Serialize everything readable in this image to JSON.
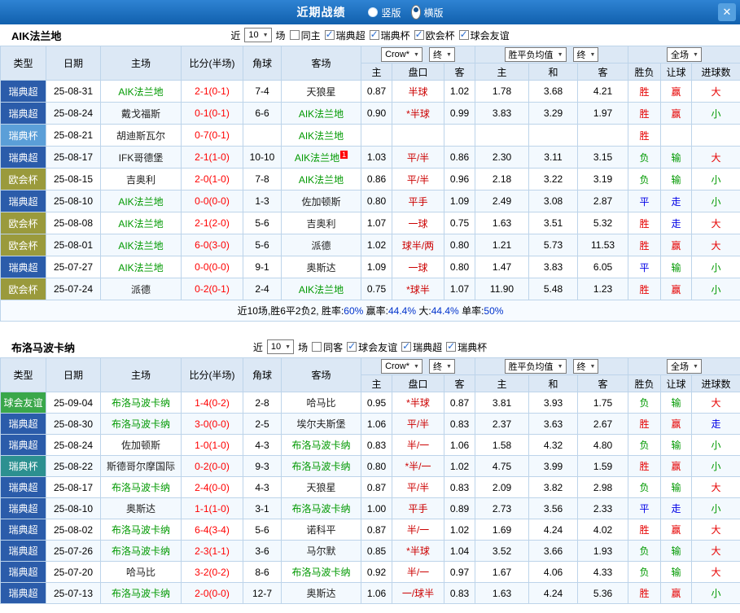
{
  "header": {
    "title": "近期战绩",
    "radios": [
      {
        "label": "竖版",
        "selected": false
      },
      {
        "label": "横版",
        "selected": true
      }
    ],
    "close_icon": "✕"
  },
  "filter_labels": {
    "near": "近",
    "games": "场"
  },
  "table_header": {
    "static_cols": [
      "类型",
      "日期",
      "主场",
      "比分(半场)",
      "角球",
      "客场"
    ],
    "odds_selects": [
      "Crow*",
      "终"
    ],
    "odds_subcols": [
      "主",
      "盘口",
      "客"
    ],
    "avg_selects": [
      "胜平负均值",
      "终"
    ],
    "avg_subcols": [
      "主",
      "和",
      "客"
    ],
    "result_selects": [
      "全场"
    ],
    "result_subcols": [
      "胜负",
      "让球",
      "进球数"
    ]
  },
  "sections": [
    {
      "team": "AIK法兰地",
      "near_count": "10",
      "checkboxes": [
        {
          "label": "同主",
          "checked": false
        },
        {
          "label": "瑞典超",
          "checked": true
        },
        {
          "label": "瑞典杯",
          "checked": true
        },
        {
          "label": "欧会杯",
          "checked": true
        },
        {
          "label": "球会友谊",
          "checked": true
        }
      ],
      "rows": [
        {
          "type": "瑞典超",
          "type_color": "#2b5caa",
          "date": "25-08-31",
          "home": "AIK法兰地",
          "home_focus": true,
          "home_sup": "",
          "score": "2-1(0-1)",
          "corner": "7-4",
          "away": "天狼星",
          "away_focus": false,
          "away_sup": "",
          "odds": [
            "0.87",
            "半球",
            "1.02"
          ],
          "avg": [
            "1.78",
            "3.68",
            "4.21"
          ],
          "results": [
            {
              "t": "胜",
              "c": "red"
            },
            {
              "t": "赢",
              "c": "red"
            },
            {
              "t": "大",
              "c": "red"
            }
          ]
        },
        {
          "type": "瑞典超",
          "type_color": "#2b5caa",
          "date": "25-08-24",
          "home": "戴戈福斯",
          "home_focus": false,
          "home_sup": "",
          "score": "0-1(0-1)",
          "corner": "6-6",
          "away": "AIK法兰地",
          "away_focus": true,
          "away_sup": "",
          "odds": [
            "0.90",
            "*半球",
            "0.99"
          ],
          "avg": [
            "3.83",
            "3.29",
            "1.97"
          ],
          "results": [
            {
              "t": "胜",
              "c": "red"
            },
            {
              "t": "赢",
              "c": "red"
            },
            {
              "t": "小",
              "c": "green"
            }
          ]
        },
        {
          "type": "瑞典杯",
          "type_color": "#5b9fd8",
          "date": "25-08-21",
          "home": "胡迪斯瓦尔",
          "home_focus": false,
          "home_sup": "",
          "score": "0-7(0-1)",
          "corner": "",
          "away": "AIK法兰地",
          "away_focus": true,
          "away_sup": "",
          "odds": [
            "",
            "",
            ""
          ],
          "avg": [
            "",
            "",
            ""
          ],
          "results": [
            {
              "t": "胜",
              "c": "red"
            },
            {
              "t": "",
              "c": ""
            },
            {
              "t": "",
              "c": ""
            }
          ]
        },
        {
          "type": "瑞典超",
          "type_color": "#2b5caa",
          "date": "25-08-17",
          "home": "IFK哥德堡",
          "home_focus": false,
          "home_sup": "",
          "score": "2-1(1-0)",
          "corner": "10-10",
          "away": "AIK法兰地",
          "away_focus": true,
          "away_sup": "1",
          "odds": [
            "1.03",
            "平/半",
            "0.86"
          ],
          "avg": [
            "2.30",
            "3.11",
            "3.15"
          ],
          "results": [
            {
              "t": "负",
              "c": "green"
            },
            {
              "t": "输",
              "c": "green"
            },
            {
              "t": "大",
              "c": "red"
            }
          ]
        },
        {
          "type": "欧会杯",
          "type_color": "#9a9a3c",
          "date": "25-08-15",
          "home": "吉奥利",
          "home_focus": false,
          "home_sup": "",
          "score": "2-0(1-0)",
          "corner": "7-8",
          "away": "AIK法兰地",
          "away_focus": true,
          "away_sup": "",
          "odds": [
            "0.86",
            "平/半",
            "0.96"
          ],
          "avg": [
            "2.18",
            "3.22",
            "3.19"
          ],
          "results": [
            {
              "t": "负",
              "c": "green"
            },
            {
              "t": "输",
              "c": "green"
            },
            {
              "t": "小",
              "c": "green"
            }
          ]
        },
        {
          "type": "瑞典超",
          "type_color": "#2b5caa",
          "date": "25-08-10",
          "home": "AIK法兰地",
          "home_focus": true,
          "home_sup": "",
          "score": "0-0(0-0)",
          "corner": "1-3",
          "away": "佐加顿斯",
          "away_focus": false,
          "away_sup": "",
          "odds": [
            "0.80",
            "平手",
            "1.09"
          ],
          "avg": [
            "2.49",
            "3.08",
            "2.87"
          ],
          "results": [
            {
              "t": "平",
              "c": "blue"
            },
            {
              "t": "走",
              "c": "blue"
            },
            {
              "t": "小",
              "c": "green"
            }
          ]
        },
        {
          "type": "欧会杯",
          "type_color": "#9a9a3c",
          "date": "25-08-08",
          "home": "AIK法兰地",
          "home_focus": true,
          "home_sup": "",
          "score": "2-1(2-0)",
          "corner": "5-6",
          "away": "吉奥利",
          "away_focus": false,
          "away_sup": "",
          "odds": [
            "1.07",
            "一球",
            "0.75"
          ],
          "avg": [
            "1.63",
            "3.51",
            "5.32"
          ],
          "results": [
            {
              "t": "胜",
              "c": "red"
            },
            {
              "t": "走",
              "c": "blue"
            },
            {
              "t": "大",
              "c": "red"
            }
          ]
        },
        {
          "type": "欧会杯",
          "type_color": "#9a9a3c",
          "date": "25-08-01",
          "home": "AIK法兰地",
          "home_focus": true,
          "home_sup": "",
          "score": "6-0(3-0)",
          "corner": "5-6",
          "away": "派德",
          "away_focus": false,
          "away_sup": "",
          "odds": [
            "1.02",
            "球半/两",
            "0.80"
          ],
          "avg": [
            "1.21",
            "5.73",
            "11.53"
          ],
          "results": [
            {
              "t": "胜",
              "c": "red"
            },
            {
              "t": "赢",
              "c": "red"
            },
            {
              "t": "大",
              "c": "red"
            }
          ]
        },
        {
          "type": "瑞典超",
          "type_color": "#2b5caa",
          "date": "25-07-27",
          "home": "AIK法兰地",
          "home_focus": true,
          "home_sup": "",
          "score": "0-0(0-0)",
          "corner": "9-1",
          "away": "奥斯达",
          "away_focus": false,
          "away_sup": "",
          "odds": [
            "1.09",
            "一球",
            "0.80"
          ],
          "avg": [
            "1.47",
            "3.83",
            "6.05"
          ],
          "results": [
            {
              "t": "平",
              "c": "blue"
            },
            {
              "t": "输",
              "c": "green"
            },
            {
              "t": "小",
              "c": "green"
            }
          ]
        },
        {
          "type": "欧会杯",
          "type_color": "#9a9a3c",
          "date": "25-07-24",
          "home": "派德",
          "home_focus": false,
          "home_sup": "",
          "score": "0-2(0-1)",
          "corner": "2-4",
          "away": "AIK法兰地",
          "away_focus": true,
          "away_sup": "",
          "odds": [
            "0.75",
            "*球半",
            "1.07"
          ],
          "avg": [
            "11.90",
            "5.48",
            "1.23"
          ],
          "results": [
            {
              "t": "胜",
              "c": "red"
            },
            {
              "t": "赢",
              "c": "red"
            },
            {
              "t": "小",
              "c": "green"
            }
          ]
        }
      ],
      "summary": [
        {
          "t": "近10场,胜6平2负2, 胜率:",
          "c": "k"
        },
        {
          "t": "60%",
          "c": "b"
        },
        {
          "t": " 赢率:",
          "c": "k"
        },
        {
          "t": "44.4%",
          "c": "b"
        },
        {
          "t": " 大:",
          "c": "k"
        },
        {
          "t": "44.4%",
          "c": "b"
        },
        {
          "t": " 单率:",
          "c": "k"
        },
        {
          "t": "50%",
          "c": "b"
        }
      ]
    },
    {
      "team": "布洛马波卡纳",
      "near_count": "10",
      "checkboxes": [
        {
          "label": "同客",
          "checked": false
        },
        {
          "label": "球会友谊",
          "checked": true
        },
        {
          "label": "瑞典超",
          "checked": true
        },
        {
          "label": "瑞典杯",
          "checked": true
        }
      ],
      "rows": [
        {
          "type": "球会友谊",
          "type_color": "#3aa74a",
          "date": "25-09-04",
          "home": "布洛马波卡纳",
          "home_focus": true,
          "home_sup": "",
          "score": "1-4(0-2)",
          "corner": "2-8",
          "away": "哈马比",
          "away_focus": false,
          "away_sup": "",
          "odds": [
            "0.95",
            "*半球",
            "0.87"
          ],
          "avg": [
            "3.81",
            "3.93",
            "1.75"
          ],
          "results": [
            {
              "t": "负",
              "c": "green"
            },
            {
              "t": "输",
              "c": "green"
            },
            {
              "t": "大",
              "c": "red"
            }
          ]
        },
        {
          "type": "瑞典超",
          "type_color": "#2b5caa",
          "date": "25-08-30",
          "home": "布洛马波卡纳",
          "home_focus": true,
          "home_sup": "",
          "score": "3-0(0-0)",
          "corner": "2-5",
          "away": "埃尔夫斯堡",
          "away_focus": false,
          "away_sup": "",
          "odds": [
            "1.06",
            "平/半",
            "0.83"
          ],
          "avg": [
            "2.37",
            "3.63",
            "2.67"
          ],
          "results": [
            {
              "t": "胜",
              "c": "red"
            },
            {
              "t": "赢",
              "c": "red"
            },
            {
              "t": "走",
              "c": "blue"
            }
          ]
        },
        {
          "type": "瑞典超",
          "type_color": "#2b5caa",
          "date": "25-08-24",
          "home": "佐加顿斯",
          "home_focus": false,
          "home_sup": "",
          "score": "1-0(1-0)",
          "corner": "4-3",
          "away": "布洛马波卡纳",
          "away_focus": true,
          "away_sup": "",
          "odds": [
            "0.83",
            "半/一",
            "1.06"
          ],
          "avg": [
            "1.58",
            "4.32",
            "4.80"
          ],
          "results": [
            {
              "t": "负",
              "c": "green"
            },
            {
              "t": "输",
              "c": "green"
            },
            {
              "t": "小",
              "c": "green"
            }
          ]
        },
        {
          "type": "瑞典杯",
          "type_color": "#2c9090",
          "date": "25-08-22",
          "home": "斯德哥尔摩国际",
          "home_focus": false,
          "home_sup": "",
          "score": "0-2(0-0)",
          "corner": "9-3",
          "away": "布洛马波卡纳",
          "away_focus": true,
          "away_sup": "",
          "odds": [
            "0.80",
            "*半/一",
            "1.02"
          ],
          "avg": [
            "4.75",
            "3.99",
            "1.59"
          ],
          "results": [
            {
              "t": "胜",
              "c": "red"
            },
            {
              "t": "赢",
              "c": "red"
            },
            {
              "t": "小",
              "c": "green"
            }
          ]
        },
        {
          "type": "瑞典超",
          "type_color": "#2b5caa",
          "date": "25-08-17",
          "home": "布洛马波卡纳",
          "home_focus": true,
          "home_sup": "",
          "score": "2-4(0-0)",
          "corner": "4-3",
          "away": "天狼星",
          "away_focus": false,
          "away_sup": "",
          "odds": [
            "0.87",
            "平/半",
            "0.83"
          ],
          "avg": [
            "2.09",
            "3.82",
            "2.98"
          ],
          "results": [
            {
              "t": "负",
              "c": "green"
            },
            {
              "t": "输",
              "c": "green"
            },
            {
              "t": "大",
              "c": "red"
            }
          ]
        },
        {
          "type": "瑞典超",
          "type_color": "#2b5caa",
          "date": "25-08-10",
          "home": "奥斯达",
          "home_focus": false,
          "home_sup": "",
          "score": "1-1(1-0)",
          "corner": "3-1",
          "away": "布洛马波卡纳",
          "away_focus": true,
          "away_sup": "",
          "odds": [
            "1.00",
            "平手",
            "0.89"
          ],
          "avg": [
            "2.73",
            "3.56",
            "2.33"
          ],
          "results": [
            {
              "t": "平",
              "c": "blue"
            },
            {
              "t": "走",
              "c": "blue"
            },
            {
              "t": "小",
              "c": "green"
            }
          ]
        },
        {
          "type": "瑞典超",
          "type_color": "#2b5caa",
          "date": "25-08-02",
          "home": "布洛马波卡纳",
          "home_focus": true,
          "home_sup": "",
          "score": "6-4(3-4)",
          "corner": "5-6",
          "away": "诺科平",
          "away_focus": false,
          "away_sup": "",
          "odds": [
            "0.87",
            "半/一",
            "1.02"
          ],
          "avg": [
            "1.69",
            "4.24",
            "4.02"
          ],
          "results": [
            {
              "t": "胜",
              "c": "red"
            },
            {
              "t": "赢",
              "c": "red"
            },
            {
              "t": "大",
              "c": "red"
            }
          ]
        },
        {
          "type": "瑞典超",
          "type_color": "#2b5caa",
          "date": "25-07-26",
          "home": "布洛马波卡纳",
          "home_focus": true,
          "home_sup": "",
          "score": "2-3(1-1)",
          "corner": "3-6",
          "away": "马尔默",
          "away_focus": false,
          "away_sup": "",
          "odds": [
            "0.85",
            "*半球",
            "1.04"
          ],
          "avg": [
            "3.52",
            "3.66",
            "1.93"
          ],
          "results": [
            {
              "t": "负",
              "c": "green"
            },
            {
              "t": "输",
              "c": "green"
            },
            {
              "t": "大",
              "c": "red"
            }
          ]
        },
        {
          "type": "瑞典超",
          "type_color": "#2b5caa",
          "date": "25-07-20",
          "home": "哈马比",
          "home_focus": false,
          "home_sup": "",
          "score": "3-2(0-2)",
          "corner": "8-6",
          "away": "布洛马波卡纳",
          "away_focus": true,
          "away_sup": "",
          "odds": [
            "0.92",
            "半/一",
            "0.97"
          ],
          "avg": [
            "1.67",
            "4.06",
            "4.33"
          ],
          "results": [
            {
              "t": "负",
              "c": "green"
            },
            {
              "t": "输",
              "c": "green"
            },
            {
              "t": "大",
              "c": "red"
            }
          ]
        },
        {
          "type": "瑞典超",
          "type_color": "#2b5caa",
          "date": "25-07-13",
          "home": "布洛马波卡纳",
          "home_focus": true,
          "home_sup": "",
          "score": "2-0(0-0)",
          "corner": "12-7",
          "away": "奥斯达",
          "away_focus": false,
          "away_sup": "",
          "odds": [
            "1.06",
            "一/球半",
            "0.83"
          ],
          "avg": [
            "1.63",
            "4.24",
            "5.36"
          ],
          "results": [
            {
              "t": "胜",
              "c": "red"
            },
            {
              "t": "赢",
              "c": "red"
            },
            {
              "t": "小",
              "c": "green"
            }
          ]
        }
      ],
      "summary": null
    }
  ]
}
